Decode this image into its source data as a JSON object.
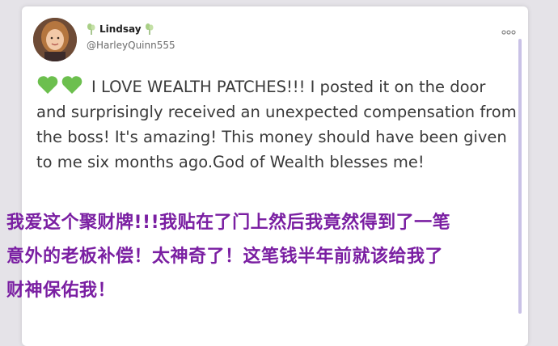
{
  "user": {
    "display_name": "Lindsay",
    "handle": "@HarleyQuinn555",
    "avatar_icon": "profile-photo"
  },
  "post": {
    "emoji": [
      "green-heart-icon",
      "green-heart-icon"
    ],
    "text": "I LOVE WEALTH PATCHES!!! I posted it on the door and surprisingly received an unexpected compensation from the boss! It's amazing! This money should have been given to me six months ago.God of Wealth blesses me!"
  },
  "caption": {
    "lines": [
      "我爱这个聚财牌!!!我贴在了门上然后我竟然得到了一笔",
      "意外的老板补偿！太神奇了！这笔钱半年前就该给我了",
      "财神保佑我！"
    ]
  },
  "colors": {
    "accent": "#c9c2e6",
    "caption": "#7a1fa2",
    "heart": "#6cbf4e"
  }
}
